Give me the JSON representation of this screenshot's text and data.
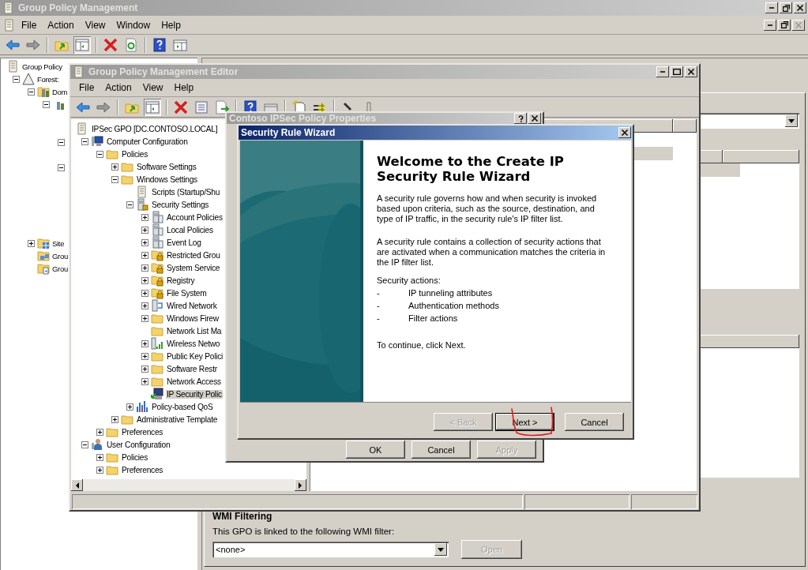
{
  "main_window": {
    "title": "Group Policy Management",
    "menu": [
      "File",
      "Action",
      "View",
      "Window",
      "Help"
    ],
    "tree": [
      {
        "label": "Group Policy",
        "kind": "gpm",
        "selected": false,
        "children": [
          {
            "label": "Forest:",
            "kind": "forest",
            "selected": false,
            "expanded": true,
            "children": [
              {
                "label": "Dom",
                "kind": "domain",
                "selected": false,
                "expanded": true,
                "children": [
                  {
                    "kind": "servers",
                    "expanded": true,
                    "children": [
                      {
                        "expanded": true
                      },
                      {
                        "expanded": true
                      }
                    ]
                  }
                ]
              },
              {
                "label": "Site",
                "kind": "sites",
                "selected": false,
                "expanded": false
              },
              {
                "label": "Grou",
                "kind": "gpo-objects",
                "selected": false
              },
              {
                "label": "Grou",
                "kind": "starter",
                "selected": false
              }
            ]
          }
        ]
      }
    ],
    "wmi": {
      "heading": "WMI Filtering",
      "description": "This GPO is linked to the following WMI filter:",
      "filter": "<none>",
      "button": {
        "label": "Open",
        "disabled": true
      }
    }
  },
  "editor_window": {
    "title": "Group Policy Management Editor",
    "menu": [
      "File",
      "Action",
      "View",
      "Help"
    ],
    "tree": [
      {
        "label": "IPSec GPO [DC.CONTOSO.LOCAL]",
        "kind": "gpo",
        "selected": false,
        "children": [
          {
            "label": "Computer Configuration",
            "kind": "computer",
            "selected": false,
            "expanded": true,
            "children": [
              {
                "label": "Policies",
                "kind": "folder",
                "selected": false,
                "expanded": true,
                "children": [
                  {
                    "label": "Software Settings",
                    "kind": "folder",
                    "selected": false,
                    "expanded": false
                  },
                  {
                    "label": "Windows Settings",
                    "kind": "folder",
                    "selected": false,
                    "expanded": true,
                    "children": [
                      {
                        "label": "Scripts (Startup/Shu",
                        "kind": "scripts",
                        "selected": false
                      },
                      {
                        "label": "Security Settings",
                        "kind": "security",
                        "selected": false,
                        "expanded": true,
                        "children": [
                          {
                            "label": "Account Policies",
                            "kind": "policy",
                            "selected": false,
                            "expanded": false
                          },
                          {
                            "label": "Local Policies",
                            "kind": "policy",
                            "selected": false,
                            "expanded": false
                          },
                          {
                            "label": "Event Log",
                            "kind": "policy",
                            "selected": false,
                            "expanded": false
                          },
                          {
                            "label": "Restricted Grou",
                            "kind": "folder-lock",
                            "selected": false,
                            "expanded": false
                          },
                          {
                            "label": "System Service",
                            "kind": "folder-lock",
                            "selected": false,
                            "expanded": false
                          },
                          {
                            "label": "Registry",
                            "kind": "folder-lock",
                            "selected": false,
                            "expanded": false
                          },
                          {
                            "label": "File System",
                            "kind": "folder-lock",
                            "selected": false,
                            "expanded": false
                          },
                          {
                            "label": "Wired Network",
                            "kind": "wired",
                            "selected": false,
                            "expanded": false
                          },
                          {
                            "label": "Windows Firew",
                            "kind": "folder",
                            "selected": false,
                            "expanded": false
                          },
                          {
                            "label": "Network List Ma",
                            "kind": "folder",
                            "selected": false
                          },
                          {
                            "label": "Wireless Netwo",
                            "kind": "wireless",
                            "selected": false,
                            "expanded": false
                          },
                          {
                            "label": "Public Key Polici",
                            "kind": "folder",
                            "selected": false,
                            "expanded": false
                          },
                          {
                            "label": "Software Restr",
                            "kind": "folder",
                            "selected": false,
                            "expanded": false
                          },
                          {
                            "label": "Network Access",
                            "kind": "folder",
                            "selected": false,
                            "expanded": false
                          },
                          {
                            "label": "IP Security Polic",
                            "kind": "ipsec",
                            "selected": true
                          }
                        ]
                      },
                      {
                        "label": "Policy-based QoS",
                        "kind": "qos",
                        "selected": false,
                        "expanded": false
                      }
                    ]
                  },
                  {
                    "label": "Administrative Template",
                    "kind": "folder",
                    "selected": false,
                    "expanded": false
                  }
                ]
              },
              {
                "label": "Preferences",
                "kind": "folder",
                "selected": false,
                "expanded": false
              }
            ]
          },
          {
            "label": "User Configuration",
            "kind": "user",
            "selected": false,
            "expanded": true,
            "children": [
              {
                "label": "Policies",
                "kind": "folder",
                "selected": false,
                "expanded": false
              },
              {
                "label": "Preferences",
                "kind": "folder",
                "selected": false,
                "expanded": false
              }
            ]
          }
        ]
      }
    ]
  },
  "properties_dialog": {
    "title": "Contoso IPSec Policy Properties",
    "buttons": [
      {
        "label": "OK",
        "disabled": false
      },
      {
        "label": "Cancel",
        "disabled": false
      },
      {
        "label": "Apply",
        "disabled": true
      }
    ]
  },
  "wizard": {
    "title": "Security Rule Wizard",
    "heading": "Welcome to the Create IP Security Rule Wizard",
    "paragraphs": [
      "A security rule governs how and when security is invoked based upon criteria, such as the source, destination, and type of IP traffic, in the security rule's IP filter list.",
      "A security rule contains a collection of security actions that are activated when a communication matches the criteria in the IP filter list."
    ],
    "actions_label": "Security actions:",
    "actions": [
      {
        "bullet": "-",
        "text": "IP tunneling attributes"
      },
      {
        "bullet": "-",
        "text": "Authentication methods"
      },
      {
        "bullet": "-",
        "text": "Filter actions"
      }
    ],
    "footer": "To continue, click Next.",
    "buttons": [
      {
        "label": "< Back",
        "disabled": true,
        "default": false
      },
      {
        "label": "Next >",
        "disabled": false,
        "default": true
      },
      {
        "label": "Cancel",
        "disabled": false,
        "default": false
      }
    ]
  }
}
